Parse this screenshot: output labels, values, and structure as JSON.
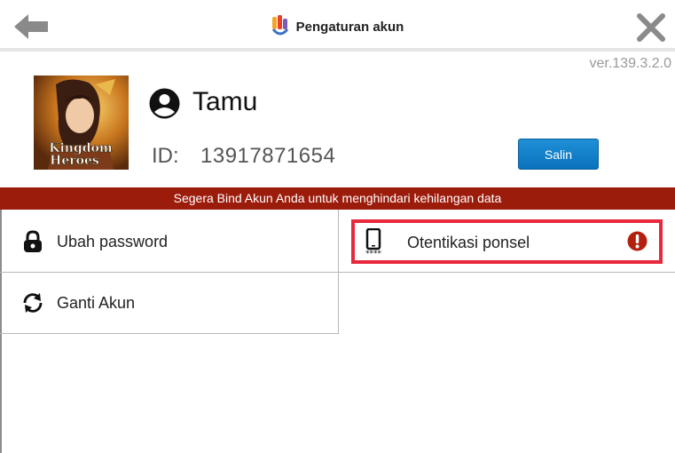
{
  "header": {
    "title": "Pengaturan akun",
    "back_icon": "arrow-left-icon",
    "close_icon": "close-icon"
  },
  "version": "ver.139.3.2.0",
  "profile": {
    "avatar_text_line1": "Kingdom",
    "avatar_text_line2": "Heroes",
    "name": "Tamu",
    "id_label": "ID:",
    "id_value": "13917871654",
    "copy_label": "Salin"
  },
  "warning": "Segera Bind Akun Anda untuk menghindari kehilangan data",
  "menu": [
    {
      "label": "Ubah password",
      "icon": "lock-icon"
    },
    {
      "label": "Otentikasi ponsel",
      "icon": "phone-icon",
      "badge_icon": "alert-icon"
    },
    {
      "label": "Ganti Akun",
      "icon": "refresh-icon"
    }
  ],
  "colors": {
    "warning_bar": "#9c1c0c",
    "copy_button": "#0a73bd",
    "highlight_border": "#e8283c",
    "alert_badge": "#b3200e"
  }
}
